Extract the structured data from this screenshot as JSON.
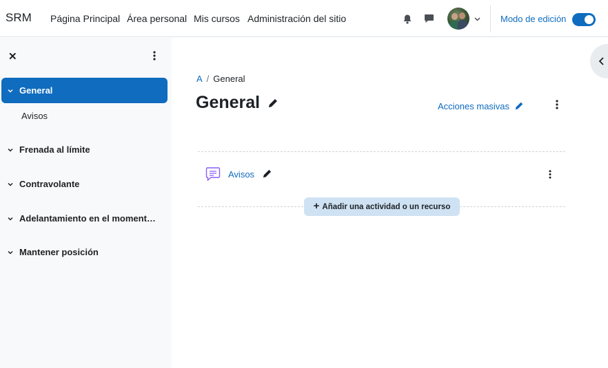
{
  "navbar": {
    "brand": "SRM",
    "items": [
      "Página Principal",
      "Área personal",
      "Mis cursos",
      "Administración del sitio"
    ],
    "edit_mode_label": "Modo de edición",
    "edit_mode_on": true
  },
  "drawer": {
    "sections": [
      {
        "label": "General",
        "active": true
      },
      {
        "label": "Frenada al límite"
      },
      {
        "label": "Contravolante"
      },
      {
        "label": "Adelantamiento en el moment…"
      },
      {
        "label": "Mantener posición"
      }
    ],
    "sub_item": "Avisos"
  },
  "main": {
    "breadcrumb": [
      "A",
      "/",
      "General"
    ],
    "title": "General",
    "bulk_actions": "Acciones masivas",
    "activity": {
      "name": "Avisos",
      "icon": "forum-icon"
    },
    "add_button": "Añadir una actividad o un recurso"
  },
  "colors": {
    "accent": "#0f6cbf",
    "drawer_bg": "#f8f9fa",
    "add_button_bg": "#cfe2f3"
  }
}
